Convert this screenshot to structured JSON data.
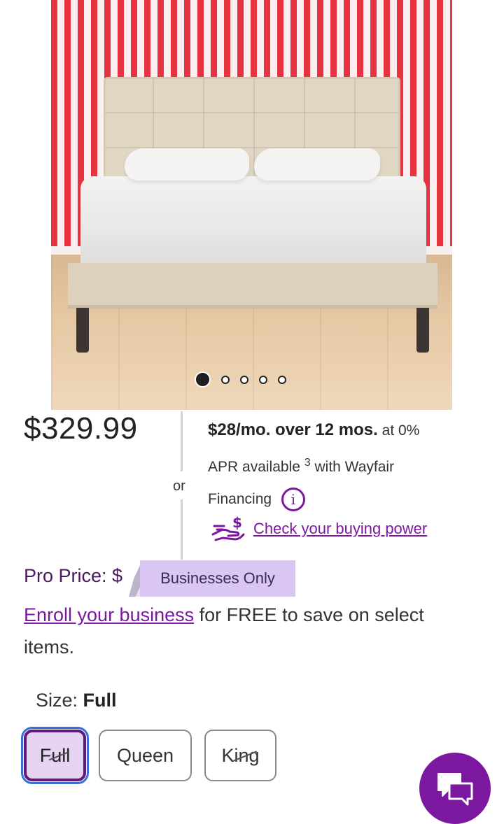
{
  "product_image": {
    "alt": "upholstered platform bed",
    "carousel": {
      "count": 5,
      "active_index": 0
    }
  },
  "pricing": {
    "price": "$329.99",
    "or_label": "or",
    "financing": {
      "monthly": "$28/mo. over 12 mos.",
      "apr_prefix": "at 0%",
      "apr_line": "APR available",
      "footnote": "3",
      "with_text": "with Wayfair",
      "financing_word": "Financing",
      "info_icon": "info-icon",
      "buying_power_icon": "hand-dollar-icon",
      "buying_power_link": "Check your buying power"
    }
  },
  "pro": {
    "label": "Pro Price: $",
    "tag": "Businesses Only",
    "enroll_link": "Enroll your business",
    "enroll_text": " for FREE to save on select items."
  },
  "size": {
    "label": "Size:",
    "selected": "Full",
    "options": [
      "Full",
      "Queen",
      "King"
    ]
  },
  "chat": {
    "icon": "chat-bubbles-icon"
  },
  "colors": {
    "brand": "#7b189f",
    "selected_bg": "#e6d4f2",
    "tag_bg": "#d9c6f5"
  }
}
